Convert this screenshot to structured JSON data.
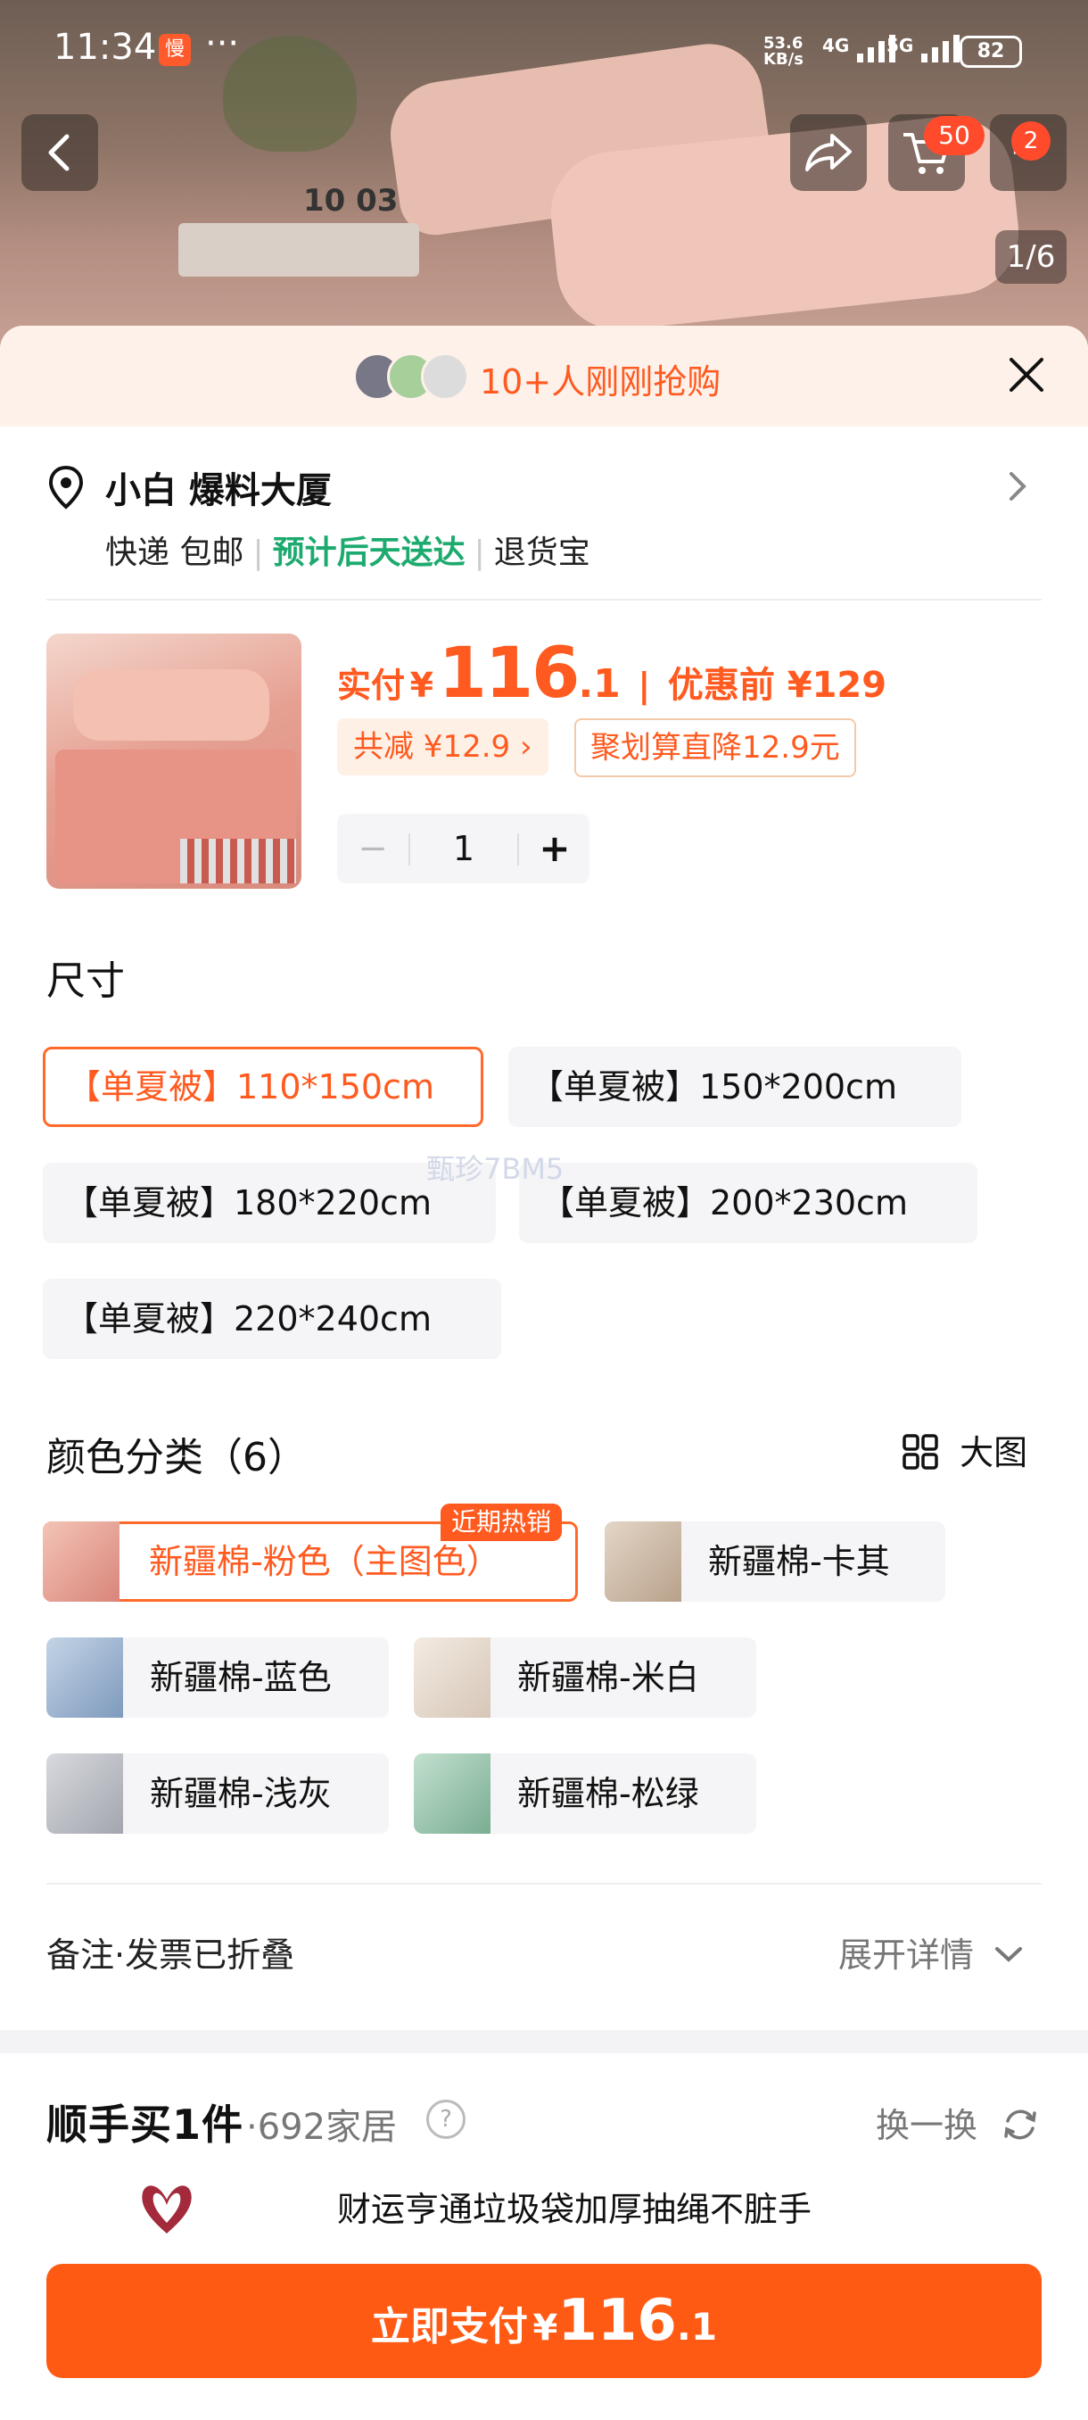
{
  "status_bar": {
    "time": "11:34",
    "app_badge": "慢",
    "more": "···",
    "net_speed_value": "53.6",
    "net_speed_unit": "KB/s",
    "signal1": "4G",
    "signal2": "5G",
    "battery": "82"
  },
  "hero": {
    "clock_text": "10 03",
    "cart_count": "50",
    "more_count": "2",
    "pager": "1/6"
  },
  "banner": {
    "text": "10+人刚刚抢购"
  },
  "address": {
    "name": "小白 爆料大厦",
    "shipping": "快递 包邮",
    "eta": "预计后天送达",
    "service": "退货宝"
  },
  "product": {
    "paid_label": "实付",
    "currency": "¥",
    "price_int": "116",
    "price_dec": ".1",
    "separator": "|",
    "original_label": "优惠前 ¥129",
    "discount_tag": "共减 ¥12.9 ›",
    "promo_tag": "聚划算直降12.9元",
    "quantity": "1",
    "minus": "−",
    "plus": "+"
  },
  "size": {
    "title": "尺寸",
    "options": [
      "【单夏被】110*150cm",
      "【单夏被】150*200cm",
      "【单夏被】180*220cm",
      "【单夏被】200*230cm",
      "【单夏被】220*240cm"
    ],
    "selected_index": 0,
    "watermark": "甄珍7BM5"
  },
  "color": {
    "title": "颜色分类（6）",
    "big_view_label": "大图",
    "hot_tag": "近期热销",
    "options": [
      {
        "label": "新疆棉-粉色（主图色）",
        "swatch": "#e59a8c"
      },
      {
        "label": "新疆棉-卡其",
        "swatch": "#c9b7a4"
      },
      {
        "label": "新疆棉-蓝色",
        "swatch": "#8fa9c9"
      },
      {
        "label": "新疆棉-米白",
        "swatch": "#e9ddd2"
      },
      {
        "label": "新疆棉-浅灰",
        "swatch": "#b9bcc4"
      },
      {
        "label": "新疆棉-松绿",
        "swatch": "#8fbfa6"
      }
    ],
    "selected_index": 0
  },
  "notes": {
    "label": "备注·发票已折叠",
    "expand": "展开详情"
  },
  "addon": {
    "title": "顺手买1件",
    "subtitle": "·692家居",
    "help": "?",
    "swap": "换一换",
    "item": "财运亨通垃圾袋加厚抽绳不脏手"
  },
  "pay": {
    "label": "立即支付",
    "currency": "¥",
    "amount_int": "116",
    "amount_dec": ".1"
  },
  "colors": {
    "accent": "#ff5a14",
    "green": "#1daa6e"
  }
}
